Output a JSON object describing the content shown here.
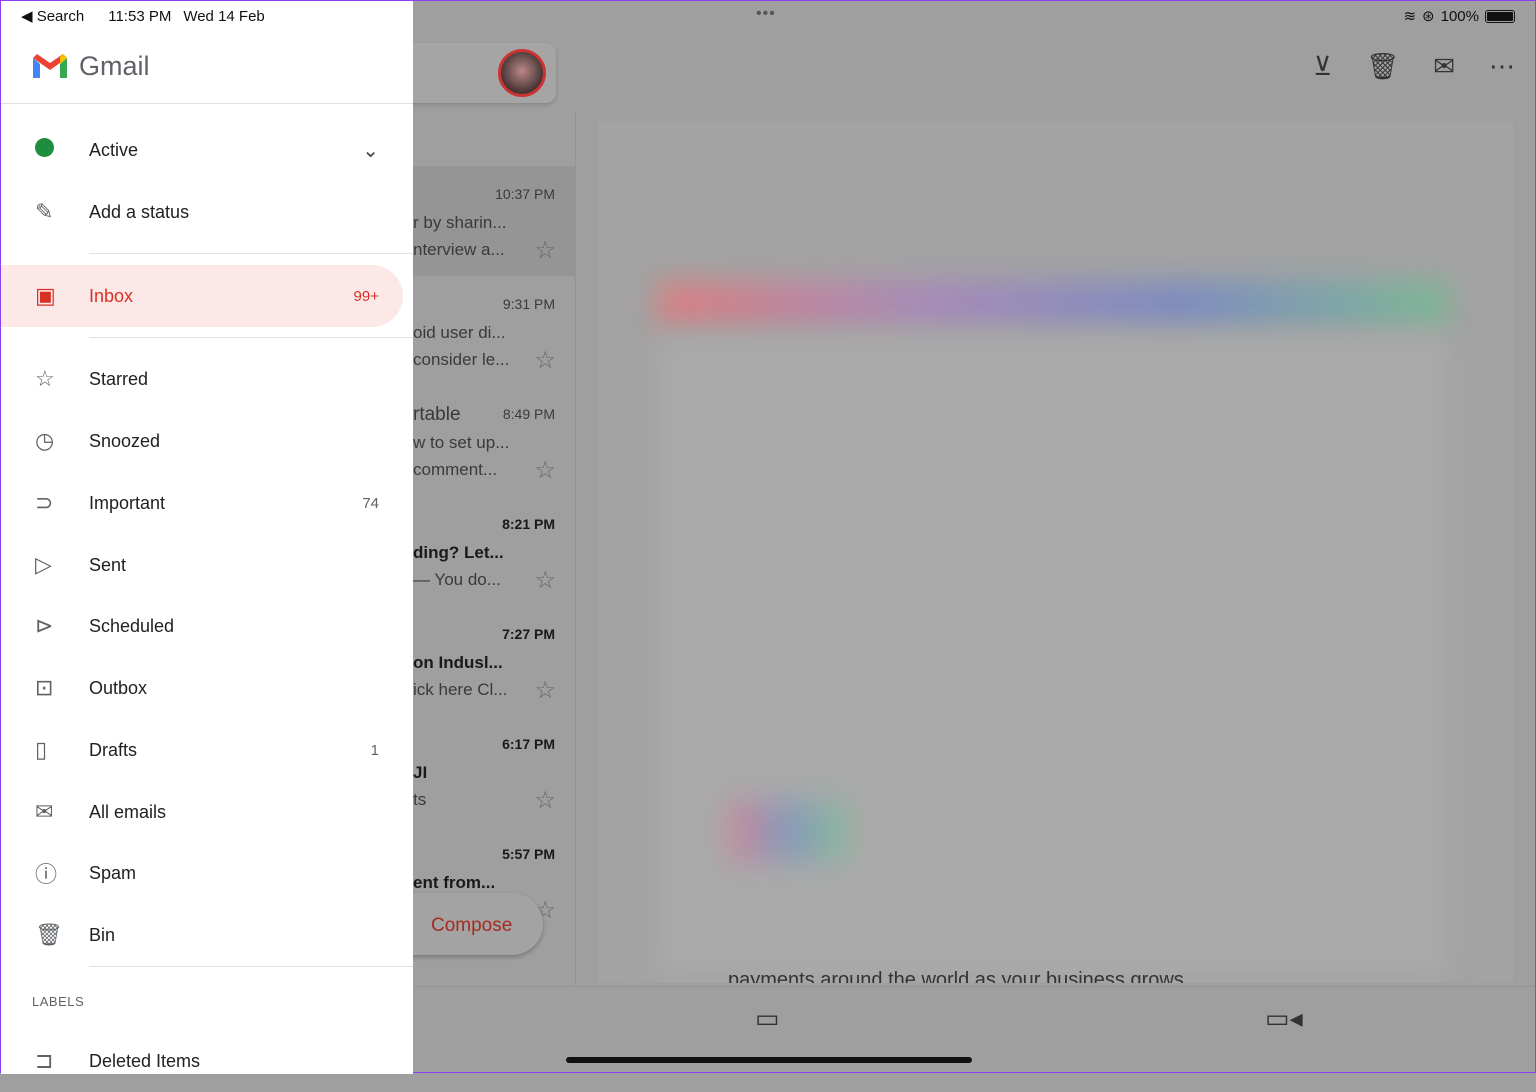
{
  "status_bar": {
    "back_label": "Search",
    "time": "11:53 PM",
    "date": "Wed 14 Feb",
    "battery": "100%"
  },
  "drawer": {
    "app_name": "Gmail",
    "status": {
      "label": "Active",
      "color": "#1e8e3e"
    },
    "add_status": "Add a status",
    "items": [
      {
        "label": "Inbox",
        "count": "99+",
        "icon": "inbox-icon"
      },
      {
        "label": "Starred",
        "count": "",
        "icon": "star-icon"
      },
      {
        "label": "Snoozed",
        "count": "",
        "icon": "clock-icon"
      },
      {
        "label": "Important",
        "count": "74",
        "icon": "important-icon"
      },
      {
        "label": "Sent",
        "count": "",
        "icon": "send-icon"
      },
      {
        "label": "Scheduled",
        "count": "",
        "icon": "scheduled-icon"
      },
      {
        "label": "Outbox",
        "count": "",
        "icon": "outbox-icon"
      },
      {
        "label": "Drafts",
        "count": "1",
        "icon": "draft-icon"
      },
      {
        "label": "All emails",
        "count": "",
        "icon": "all-mail-icon"
      },
      {
        "label": "Spam",
        "count": "",
        "icon": "spam-icon"
      },
      {
        "label": "Bin",
        "count": "",
        "icon": "trash-icon"
      }
    ],
    "labels_heading": "LABELS",
    "labels": [
      {
        "label": "Deleted Items"
      }
    ]
  },
  "email_list": [
    {
      "time": "10:37 PM",
      "line1": "r by sharin...",
      "line2": "nterview a...",
      "unread": false,
      "selected": true
    },
    {
      "time": "9:31 PM",
      "line1": "oid user di...",
      "line2": "consider le...",
      "unread": false
    },
    {
      "time": "8:49 PM",
      "line1": "rtable",
      "line2": "w to set up...",
      "line3": "comment...",
      "unread": false
    },
    {
      "time": "8:21 PM",
      "line1": "ding? Let...",
      "line2": "— You do...",
      "unread": true
    },
    {
      "time": "7:27 PM",
      "line1": "on Indusl...",
      "line2": "ick here Cl...",
      "unread": true
    },
    {
      "time": "6:17 PM",
      "line1": "JI",
      "line2": "ts",
      "unread": true
    },
    {
      "time": "5:57 PM",
      "line1": "ent from...",
      "line2": "",
      "unread": true
    }
  ],
  "compose_label": "Compose",
  "reading_pane": {
    "visible_text": "payments around the world as your business grows."
  },
  "accent": "#d93025"
}
